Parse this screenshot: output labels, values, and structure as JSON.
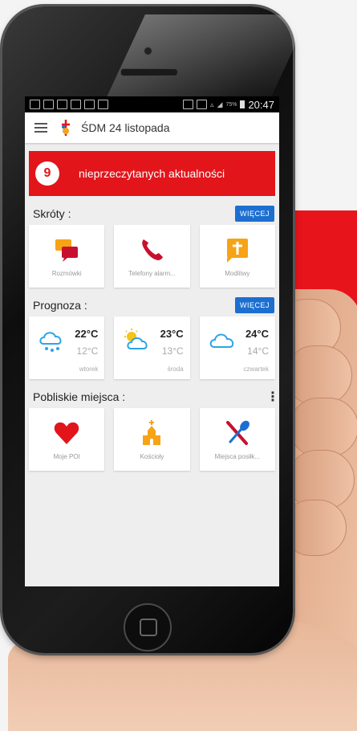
{
  "statusbar": {
    "time": "20:47",
    "battery": "75%"
  },
  "appbar": {
    "title": "ŚDM 24 listopada"
  },
  "banner": {
    "count": "9",
    "text": "nieprzeczytanych aktualności"
  },
  "shortcuts": {
    "title": "Skróty :",
    "more_label": "WIĘCEJ",
    "items": [
      {
        "label": "Rozmówki",
        "icon": "chat-bubbles-icon"
      },
      {
        "label": "Telefony alarm...",
        "icon": "phone-icon"
      },
      {
        "label": "Modlitwy",
        "icon": "prayer-cross-icon"
      }
    ]
  },
  "forecast": {
    "title": "Prognoza :",
    "more_label": "WIĘCEJ",
    "days": [
      {
        "high": "22°C",
        "low": "12°C",
        "day": "wtorek",
        "icon": "rain-cloud-icon"
      },
      {
        "high": "23°C",
        "low": "13°C",
        "day": "środa",
        "icon": "sun-cloud-icon"
      },
      {
        "high": "24°C",
        "low": "14°C",
        "day": "czwartek",
        "icon": "cloud-icon"
      }
    ]
  },
  "nearby": {
    "title": "Pobliskie miejsca :",
    "items": [
      {
        "label": "Moje POI",
        "icon": "heart-icon"
      },
      {
        "label": "Kościoły",
        "icon": "church-icon"
      },
      {
        "label": "Miejsca posiłk...",
        "icon": "cutlery-icon"
      }
    ]
  },
  "colors": {
    "accent_red": "#e2151b",
    "button_blue": "#1c6fd1",
    "icon_orange": "#f6a316",
    "icon_dark_red": "#c8102e"
  }
}
